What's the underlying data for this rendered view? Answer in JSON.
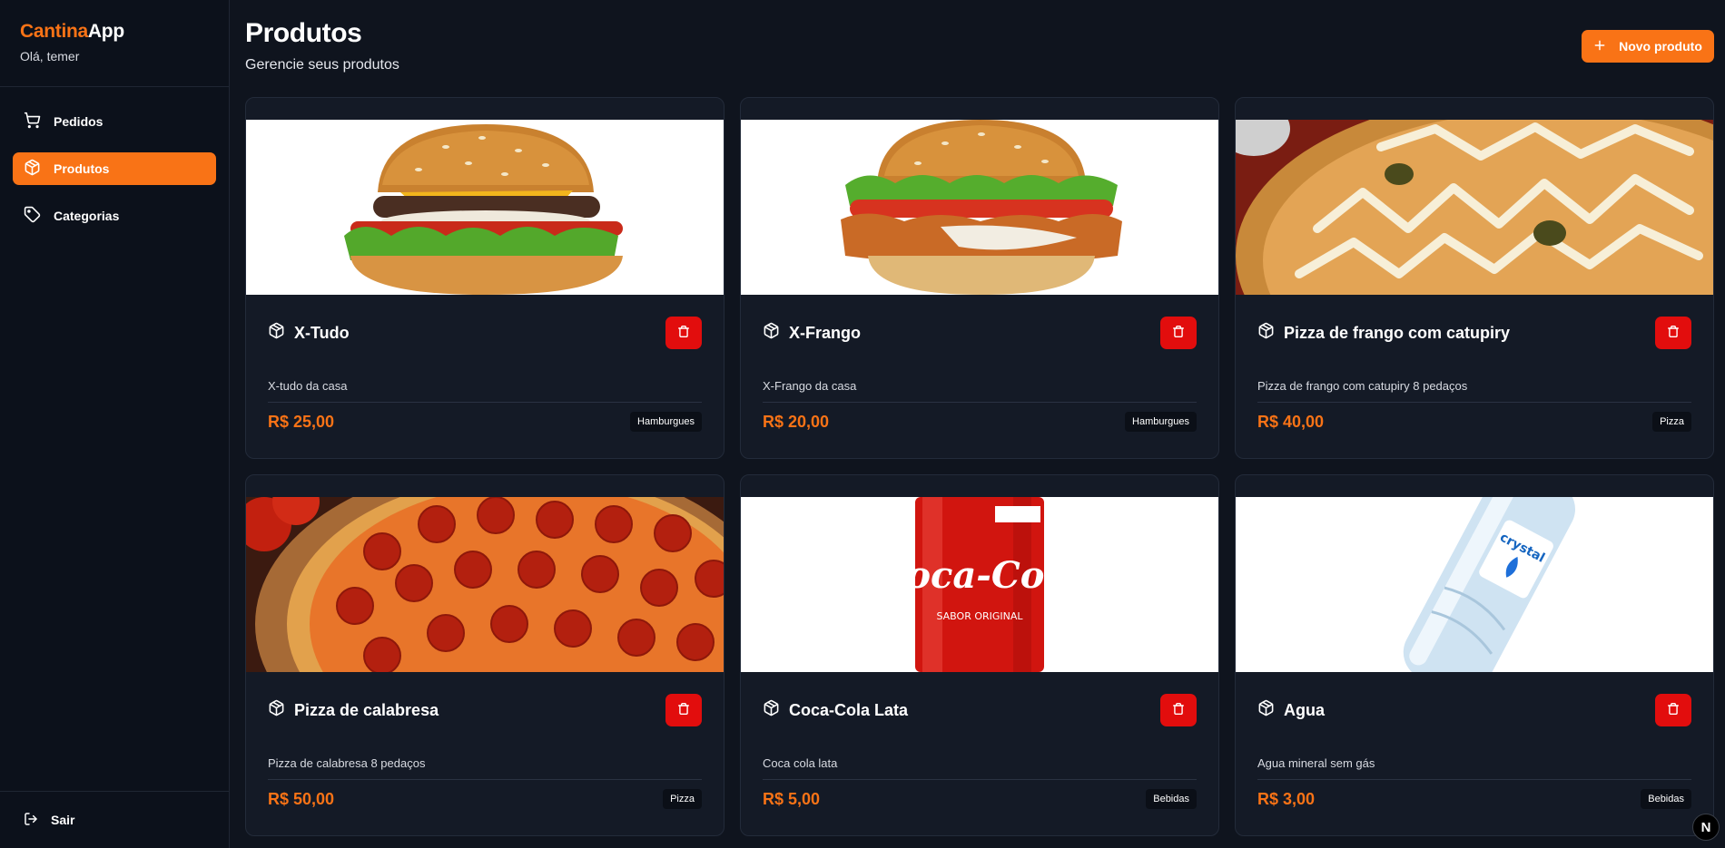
{
  "brand": {
    "name_accent": "Cantina",
    "name_rest": "App",
    "greeting": "Olá, temer"
  },
  "sidebar": {
    "items": [
      {
        "label": "Pedidos",
        "icon": "cart-icon",
        "active": false
      },
      {
        "label": "Produtos",
        "icon": "box-icon",
        "active": true
      },
      {
        "label": "Categorias",
        "icon": "tag-icon",
        "active": false
      }
    ],
    "logout_label": "Sair"
  },
  "header": {
    "title": "Produtos",
    "subtitle": "Gerencie seus produtos",
    "new_button_label": "Novo produto"
  },
  "products": [
    {
      "name": "X-Tudo",
      "description": "X-tudo da casa",
      "price": "R$ 25,00",
      "category": "Hamburgues",
      "image": "burger"
    },
    {
      "name": "X-Frango",
      "description": "X-Frango da casa",
      "price": "R$ 20,00",
      "category": "Hamburgues",
      "image": "chicken-burger"
    },
    {
      "name": "Pizza de frango com catupiry",
      "description": "Pizza de frango com catupiry 8 pedaços",
      "price": "R$ 40,00",
      "category": "Pizza",
      "image": "pizza-chicken"
    },
    {
      "name": "Pizza de calabresa",
      "description": "Pizza de calabresa 8 pedaços",
      "price": "R$ 50,00",
      "category": "Pizza",
      "image": "pizza-pepperoni"
    },
    {
      "name": "Coca-Cola Lata",
      "description": "Coca cola lata",
      "price": "R$ 5,00",
      "category": "Bebidas",
      "image": "coke-can",
      "image_text": "Coca-Cola",
      "image_subtext": "SABOR ORIGINAL"
    },
    {
      "name": "Agua",
      "description": "Agua mineral sem gás",
      "price": "R$ 3,00",
      "category": "Bebidas",
      "image": "water-bottle",
      "image_text": "crystal"
    }
  ],
  "dev_badge": "N",
  "colors": {
    "accent": "#f97316",
    "danger": "#e20d0d",
    "background": "#0f141e",
    "card": "#141a26"
  }
}
